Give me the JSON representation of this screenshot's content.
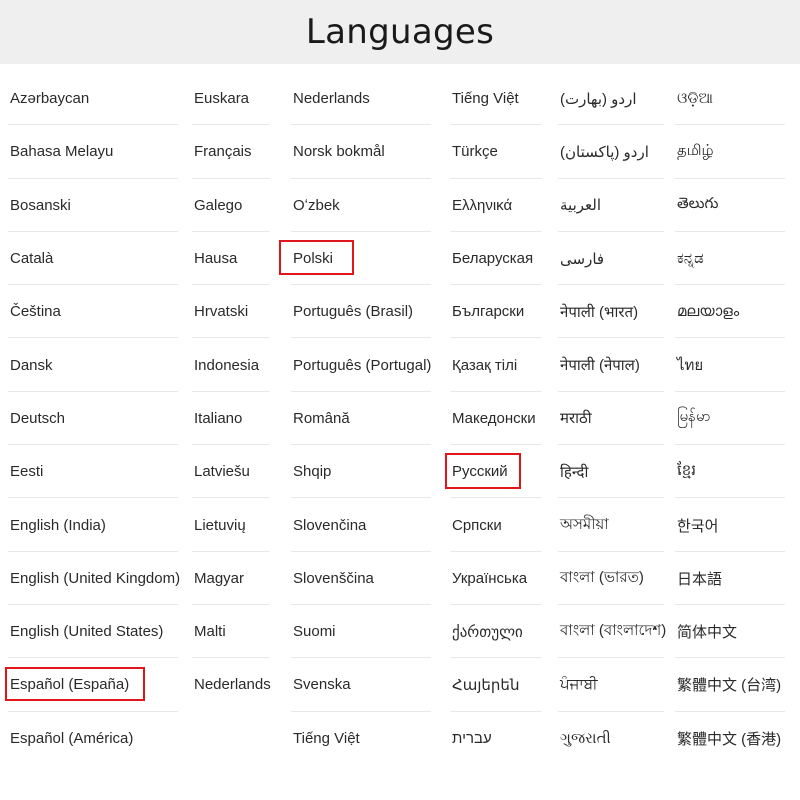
{
  "header": {
    "title": "Languages"
  },
  "columns": [
    [
      "Azərbaycan",
      "Bahasa Melayu",
      "Bosanski",
      "Català",
      "Čeština",
      "Dansk",
      "Deutsch",
      "Eesti",
      "English (India)",
      "English (United Kingdom)",
      "English (United States)",
      "Español (España)",
      "Español (América)"
    ],
    [
      "Euskara",
      "Français",
      "Galego",
      "Hausa",
      "Hrvatski",
      "Indonesia",
      "Italiano",
      "Latviešu",
      "Lietuvių",
      "Magyar",
      "Malti",
      "Nederlands"
    ],
    [
      "Nederlands",
      "Norsk bokmål",
      "Oʻzbek",
      "Polski",
      "Português (Brasil)",
      "Português (Portugal)",
      "Română",
      "Shqip",
      "Slovenčina",
      "Slovenščina",
      "Suomi",
      "Svenska",
      "Tiếng Việt"
    ],
    [
      "Tiếng Việt",
      "Türkçe",
      "Ελληνικά",
      "Беларуская",
      "Български",
      "Қазақ тілі",
      "Македонски",
      "Русский",
      "Српски",
      "Українська",
      "ქართული",
      "Հայերեն",
      "עברית"
    ],
    [
      "اردو (بھارت)",
      "اردو (پاکستان)",
      "العربية",
      "فارسی",
      "नेपाली (भारत)",
      "नेपाली (नेपाल)",
      "मराठी",
      "हिन्दी",
      "অসমীয়া",
      "বাংলা (ভারত)",
      "বাংলা (বাংলাদেশ)",
      "ਪੰਜਾਬੀ",
      "ગુજરાતી"
    ],
    [
      "ଓଡ଼ିଆ",
      "தமிழ்",
      "తెలుగు",
      "ಕನ್ನಡ",
      "മലയാളം",
      "ไทย",
      "မြန်မာ",
      "ខ្មែរ",
      "한국어",
      "日本語",
      "简体中文",
      "繁體中文 (台湾)",
      "繁體中文 (香港)"
    ]
  ],
  "highlighted": [
    "Español (España)",
    "Polski",
    "Русский"
  ],
  "colors": {
    "highlight_border": "#e0161b",
    "header_bg": "#efefef"
  }
}
